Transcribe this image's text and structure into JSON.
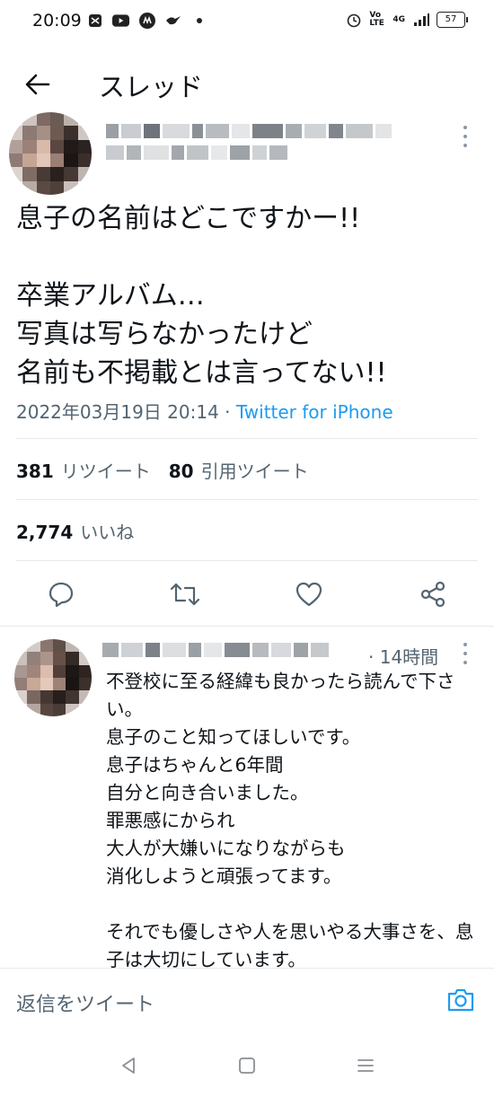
{
  "status": {
    "time": "20:09",
    "network": "4G",
    "volte": "Vo LTE",
    "battery": "57"
  },
  "header": {
    "title": "スレッド",
    "back_icon": "arrow-left-icon"
  },
  "tweet": {
    "text": "息子の名前はどこですかー!!\n\n卒業アルバム…\n写真は写らなかったけど\n名前も不掲載とは言ってない!!",
    "date": "2022年03月19日 20:14",
    "separator": " · ",
    "source": "Twitter for iPhone",
    "retweet_count": "381",
    "retweet_label": "リツイート",
    "quote_count": "80",
    "quote_label": "引用ツイート",
    "like_count": "2,774",
    "like_label": "いいね"
  },
  "actions": {
    "reply_icon": "reply-icon",
    "retweet_icon": "retweet-icon",
    "like_icon": "heart-icon",
    "share_icon": "share-icon"
  },
  "reply": {
    "time": "· 14時間",
    "text": "不登校に至る経緯も良かったら読んで下さい。\n息子のこと知ってほしいです。\n息子はちゃんと6年間\n自分と向き合いました。\n罪悪感にかられ\n大人が大嫌いになりながらも\n消化しようと頑張ってます。\n\nそれでも優しさや人を思いやる大事さを、息子は大切にしています。"
  },
  "composer": {
    "placeholder": "返信をツイート"
  },
  "colors": {
    "accent": "#1d9bf0",
    "secondary_text": "#536471"
  }
}
